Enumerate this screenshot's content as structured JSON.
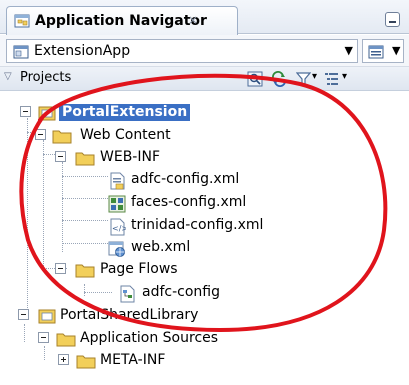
{
  "panel": {
    "title": "Application Navigator",
    "close_glyph": "×"
  },
  "application": {
    "selected": "ExtensionApp"
  },
  "projects": {
    "label": "Projects"
  },
  "tree": {
    "portal_extension": "PortalExtension",
    "web_content": "Web Content",
    "web_inf": "WEB-INF",
    "adfc_config_xml": "adfc-config.xml",
    "faces_config_xml": "faces-config.xml",
    "trinidad_config_xml": "trinidad-config.xml",
    "web_xml": "web.xml",
    "page_flows": "Page Flows",
    "adfc_config": "adfc-config",
    "portal_shared_library": "PortalSharedLibrary",
    "application_sources": "Application Sources",
    "meta_inf": "META-INF"
  },
  "colors": {
    "selection": "#3a6fc4",
    "annotation": "#e0141c",
    "folder": "#f2cf5a"
  },
  "icons": [
    "application-navigator-icon",
    "close-icon",
    "minimize-icon",
    "application-icon",
    "dropdown-arrow-icon",
    "application-menu-icon",
    "collapse-triangle-icon",
    "refresh-icon",
    "sync-icon",
    "filter-icon",
    "sort-icon",
    "folder-icon",
    "project-icon",
    "xml-file-icon",
    "faces-config-icon",
    "trinidad-config-icon",
    "web-xml-icon",
    "task-flow-icon",
    "expand-icon",
    "collapse-icon"
  ]
}
